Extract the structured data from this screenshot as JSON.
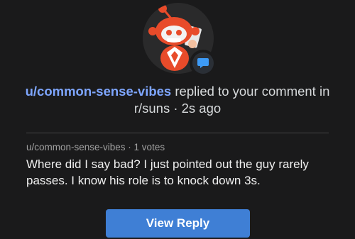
{
  "notification": {
    "username": "u/common-sense-vibes",
    "action_text": " replied to your comment in r/suns · 2s ago",
    "badge_icon": "chat-bubble-icon",
    "avatar_icon": "snoo-avatar-icon"
  },
  "reply": {
    "meta": "u/common-sense-vibes · 1 votes",
    "body": "Where did I say bad? I just pointed out the guy rarely passes. I know his role is to knock down 3s."
  },
  "button": {
    "label": "View Reply"
  },
  "colors": {
    "accent": "#3f7fd5",
    "username": "#7ea6ff",
    "background": "#1a1a1b"
  }
}
